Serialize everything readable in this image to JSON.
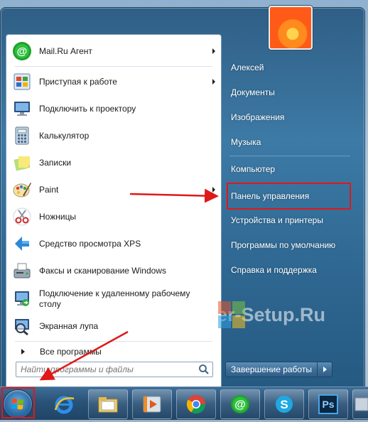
{
  "start_menu": {
    "programs": [
      {
        "id": "mailru",
        "label": "Mail.Ru Агент",
        "icon": "mailru-agent-icon",
        "has_submenu": true
      },
      {
        "id": "getting-started",
        "label": "Приступая к работе",
        "icon": "getting-started-icon",
        "has_submenu": true
      },
      {
        "id": "projector",
        "label": "Подключить к проектору",
        "icon": "projector-icon",
        "has_submenu": false
      },
      {
        "id": "calculator",
        "label": "Калькулятор",
        "icon": "calculator-icon",
        "has_submenu": false
      },
      {
        "id": "sticky-notes",
        "label": "Записки",
        "icon": "sticky-notes-icon",
        "has_submenu": false
      },
      {
        "id": "paint",
        "label": "Paint",
        "icon": "paint-icon",
        "has_submenu": true
      },
      {
        "id": "snipping",
        "label": "Ножницы",
        "icon": "scissors-icon",
        "has_submenu": false
      },
      {
        "id": "xps",
        "label": "Средство просмотра XPS",
        "icon": "xps-viewer-icon",
        "has_submenu": false
      },
      {
        "id": "fax",
        "label": "Факсы и сканирование Windows",
        "icon": "fax-scan-icon",
        "has_submenu": false
      },
      {
        "id": "rdp",
        "label": "Подключение к удаленному рабочему столу",
        "label_line1": "Подключение к удаленному рабочему",
        "label_line2": "столу",
        "icon": "remote-desktop-icon",
        "has_submenu": false
      },
      {
        "id": "magnifier",
        "label": "Экранная лупа",
        "icon": "magnifier-icon",
        "has_submenu": false
      }
    ],
    "all_programs_label": "Все программы",
    "search_placeholder": "Найти программы и файлы",
    "right_items": [
      {
        "id": "user",
        "label": "Алексей"
      },
      {
        "id": "documents",
        "label": "Документы"
      },
      {
        "id": "pictures",
        "label": "Изображения"
      },
      {
        "id": "music",
        "label": "Музыка"
      },
      {
        "id": "computer",
        "label": "Компьютер"
      },
      {
        "id": "control-panel",
        "label": "Панель управления",
        "highlighted": true
      },
      {
        "id": "devices",
        "label": "Устройства и принтеры"
      },
      {
        "id": "default-programs",
        "label": "Программы по умолчанию"
      },
      {
        "id": "help",
        "label": "Справка и поддержка"
      }
    ],
    "shutdown_label": "Завершение работы"
  },
  "watermark": "Computer-Setup.Ru",
  "taskbar": {
    "items": [
      "internet-explorer-icon",
      "file-explorer-icon",
      "media-player-icon",
      "chrome-icon",
      "mailru-agent-icon",
      "skype-icon",
      "photoshop-icon",
      "program-icon"
    ],
    "photoshop_label": "Ps"
  },
  "colors": {
    "highlight_red": "#e01818",
    "menu_glass": "#2f5f86"
  }
}
